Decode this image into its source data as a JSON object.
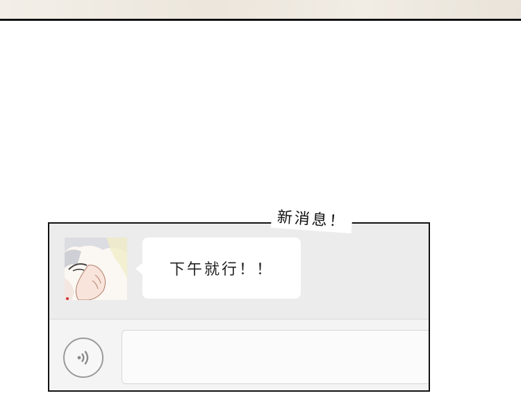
{
  "notification": {
    "label": "新消息！"
  },
  "chat": {
    "messages": [
      {
        "sender": "contact",
        "text": "下午就行！！"
      }
    ]
  },
  "input_bar": {
    "voice_icon": "voice-wave-icon",
    "text_value": ""
  },
  "colors": {
    "panel_bg": "#ececec",
    "bubble_bg": "#ffffff",
    "frame_border": "#111111",
    "icon_gray": "#8a8a8a"
  }
}
